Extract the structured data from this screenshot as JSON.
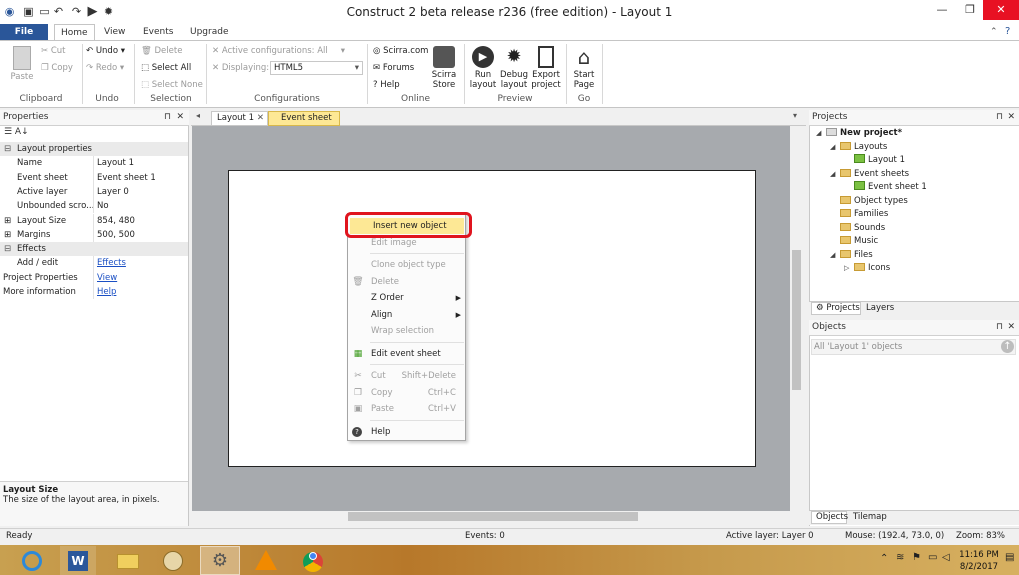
{
  "window": {
    "title": "Construct 2 beta release r236  (free edition) - Layout 1"
  },
  "ribbon_tabs": [
    "File",
    "Home",
    "View",
    "Events",
    "Upgrade"
  ],
  "ribbon": {
    "clipboard": {
      "paste": "Paste",
      "cut": "Cut",
      "copy": "Copy",
      "label": "Clipboard"
    },
    "undo": {
      "undo": "Undo",
      "redo": "Redo",
      "label": "Undo"
    },
    "selection": {
      "delete": "Delete",
      "select_all": "Select All",
      "select_none": "Select None",
      "label": "Selection"
    },
    "configurations": {
      "active": "Active configurations: All",
      "displaying_label": "Displaying:",
      "displaying_value": "HTML5",
      "label": "Configurations"
    },
    "online": {
      "scirra": "Scirra.com",
      "forums": "Forums",
      "help": "Help",
      "store": "Scirra Store",
      "label": "Online"
    },
    "preview": {
      "run": "Run layout",
      "debug": "Debug layout",
      "export": "Export project",
      "label": "Preview"
    },
    "go": {
      "start": "Start Page",
      "label": "Go"
    }
  },
  "properties": {
    "title": "Properties",
    "rows": [
      {
        "type": "cat",
        "name": "Layout properties"
      },
      {
        "type": "prop",
        "name": "Name",
        "value": "Layout 1"
      },
      {
        "type": "prop",
        "name": "Event sheet",
        "value": "Event sheet 1"
      },
      {
        "type": "prop",
        "name": "Active layer",
        "value": "Layer 0"
      },
      {
        "type": "prop",
        "name": "Unbounded scro...",
        "value": "No"
      },
      {
        "type": "prop",
        "name": "Layout Size",
        "value": "854, 480",
        "expand": true,
        "selected": true
      },
      {
        "type": "prop",
        "name": "Margins",
        "value": "500, 500",
        "expand": true
      },
      {
        "type": "cat",
        "name": "Effects"
      },
      {
        "type": "link",
        "name": "Add / edit",
        "value": "Effects"
      },
      {
        "type": "link",
        "name": "Project Properties",
        "value": "View",
        "top_level": true
      },
      {
        "type": "link",
        "name": "More information",
        "value": "Help",
        "top_level": true
      }
    ],
    "help_title": "Layout Size",
    "help_text": "The size of the layout area, in pixels."
  },
  "doc_tabs": [
    "Layout 1",
    "Event sheet 1"
  ],
  "context_menu": [
    {
      "label": "Insert new object",
      "enabled": true,
      "highlight": true
    },
    {
      "label": "Edit image",
      "enabled": false
    },
    {
      "sep": true
    },
    {
      "label": "Clone object type",
      "enabled": false
    },
    {
      "label": "Delete",
      "enabled": false,
      "icon": "trash-icon"
    },
    {
      "label": "Z Order",
      "enabled": true,
      "submenu": true
    },
    {
      "label": "Align",
      "enabled": true,
      "submenu": true
    },
    {
      "label": "Wrap selection",
      "enabled": false
    },
    {
      "sep": true
    },
    {
      "label": "Edit event sheet",
      "enabled": true,
      "icon": "event-sheet-icon"
    },
    {
      "sep": true
    },
    {
      "label": "Cut",
      "enabled": false,
      "shortcut": "Shift+Delete",
      "icon": "scissors-icon"
    },
    {
      "label": "Copy",
      "enabled": false,
      "shortcut": "Ctrl+C",
      "icon": "copy-icon"
    },
    {
      "label": "Paste",
      "enabled": false,
      "shortcut": "Ctrl+V",
      "icon": "paste-icon"
    },
    {
      "sep": true
    },
    {
      "label": "Help",
      "enabled": true,
      "icon": "help-icon"
    }
  ],
  "projects": {
    "title": "Projects",
    "tree": [
      {
        "label": "New project*",
        "level": 0,
        "bold": true,
        "arrow": "open"
      },
      {
        "label": "Layouts",
        "level": 1,
        "arrow": "open",
        "icon": "folder"
      },
      {
        "label": "Layout 1",
        "level": 2,
        "icon": "layout"
      },
      {
        "label": "Event sheets",
        "level": 1,
        "arrow": "open",
        "icon": "folder"
      },
      {
        "label": "Event sheet 1",
        "level": 2,
        "icon": "sheet"
      },
      {
        "label": "Object types",
        "level": 1,
        "icon": "folder"
      },
      {
        "label": "Families",
        "level": 1,
        "icon": "folder"
      },
      {
        "label": "Sounds",
        "level": 1,
        "icon": "folder"
      },
      {
        "label": "Music",
        "level": 1,
        "icon": "folder"
      },
      {
        "label": "Files",
        "level": 1,
        "arrow": "open",
        "icon": "folder"
      },
      {
        "label": "Icons",
        "level": 2,
        "arrow": "closed",
        "icon": "folder"
      }
    ],
    "tabs": [
      "Projects",
      "Layers"
    ]
  },
  "objects": {
    "title": "Objects",
    "filter": "All 'Layout 1' objects",
    "tabs": [
      "Objects",
      "Tilemap"
    ]
  },
  "status": {
    "ready": "Ready",
    "events": "Events: 0",
    "active_layer": "Active layer: Layer 0",
    "mouse": "Mouse: (192.4, 73.0, 0)",
    "zoom": "Zoom: 83%"
  },
  "taskbar": {
    "time": "11:16 PM",
    "date": "8/2/2017"
  },
  "colors": {
    "accent": "#2a5699",
    "highlight": "#fde895",
    "callout": "#e0141e"
  }
}
